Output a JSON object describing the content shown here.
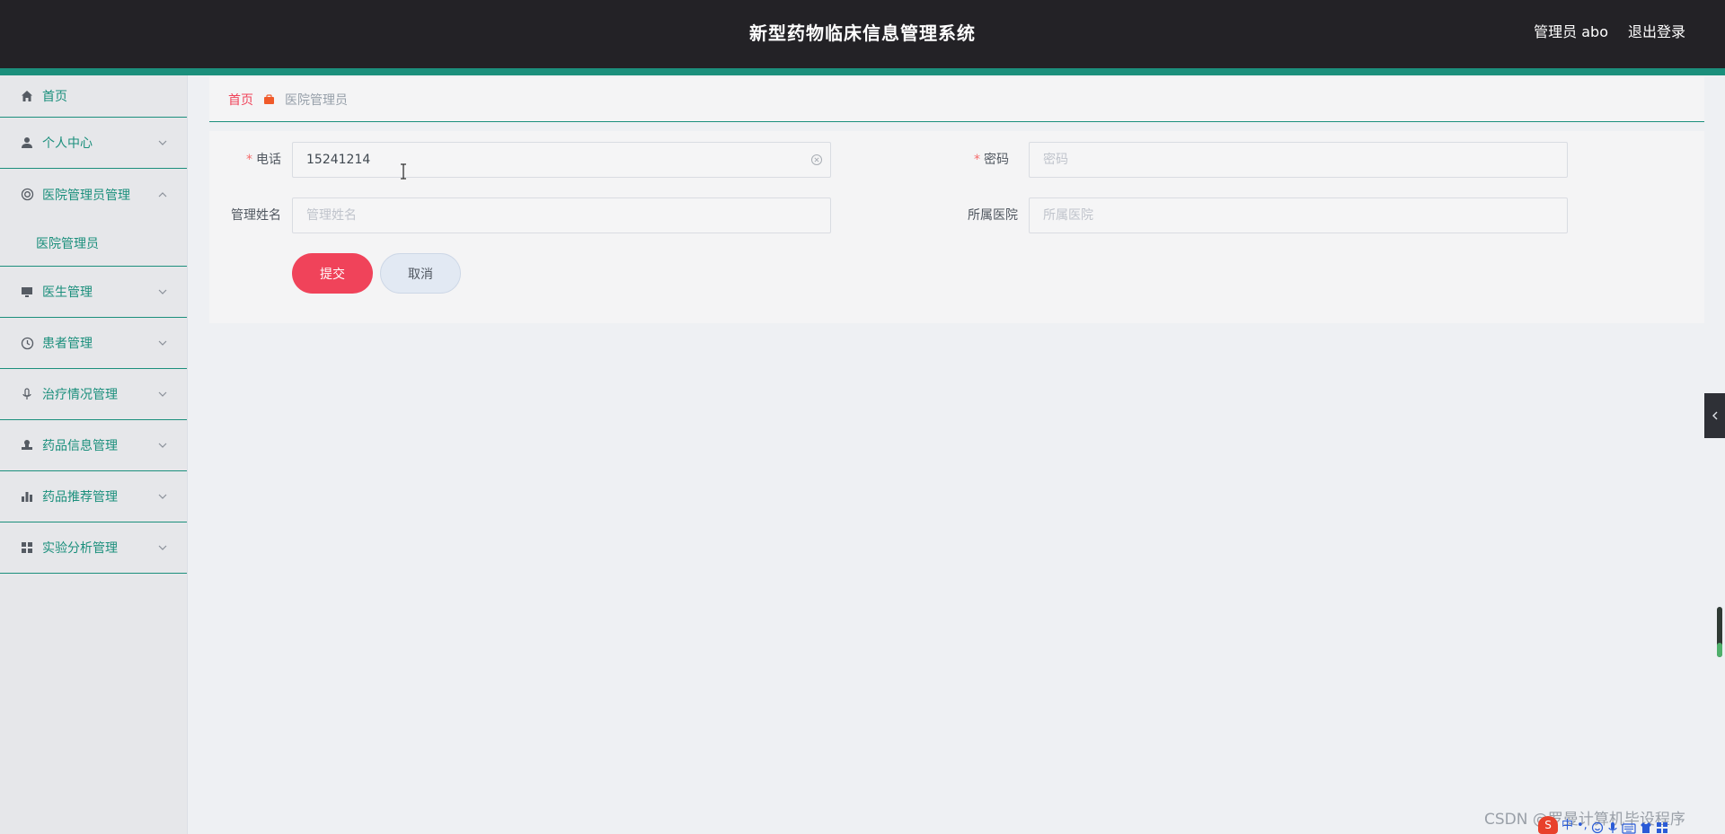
{
  "header": {
    "title": "新型药物临床信息管理系统",
    "user": "管理员 abo",
    "logout": "退出登录"
  },
  "sidebar": {
    "items": [
      {
        "label": "首页",
        "icon": "home-icon"
      },
      {
        "label": "个人中心",
        "icon": "user-icon"
      },
      {
        "label": "医院管理员管理",
        "icon": "lifebuoy-icon",
        "expanded": true,
        "children": [
          {
            "label": "医院管理员"
          }
        ]
      },
      {
        "label": "医生管理",
        "icon": "monitor-icon"
      },
      {
        "label": "患者管理",
        "icon": "clock-icon"
      },
      {
        "label": "治疗情况管理",
        "icon": "microphone-icon"
      },
      {
        "label": "药品信息管理",
        "icon": "stamp-icon"
      },
      {
        "label": "药品推荐管理",
        "icon": "bar-chart-icon"
      },
      {
        "label": "实验分析管理",
        "icon": "grid-icon"
      }
    ]
  },
  "breadcrumb": {
    "home": "首页",
    "current": "医院管理员"
  },
  "form": {
    "phone": {
      "label": "电话",
      "required": true,
      "value": "15241214",
      "placeholder": "电话"
    },
    "password": {
      "label": "密码",
      "required": true,
      "value": "",
      "placeholder": "密码"
    },
    "admin_name": {
      "label": "管理姓名",
      "required": false,
      "value": "",
      "placeholder": "管理姓名"
    },
    "hospital": {
      "label": "所属医院",
      "required": false,
      "value": "",
      "placeholder": "所属医院"
    },
    "submit_label": "提交",
    "cancel_label": "取消"
  },
  "overlay": {
    "watermark": "CSDN @罗曼计算机毕设程序",
    "tray_ime": "中",
    "tray_punct": "•,"
  },
  "colors": {
    "header_bg": "#232226",
    "accent": "#1b8f7c",
    "primary": "#f0435a"
  }
}
